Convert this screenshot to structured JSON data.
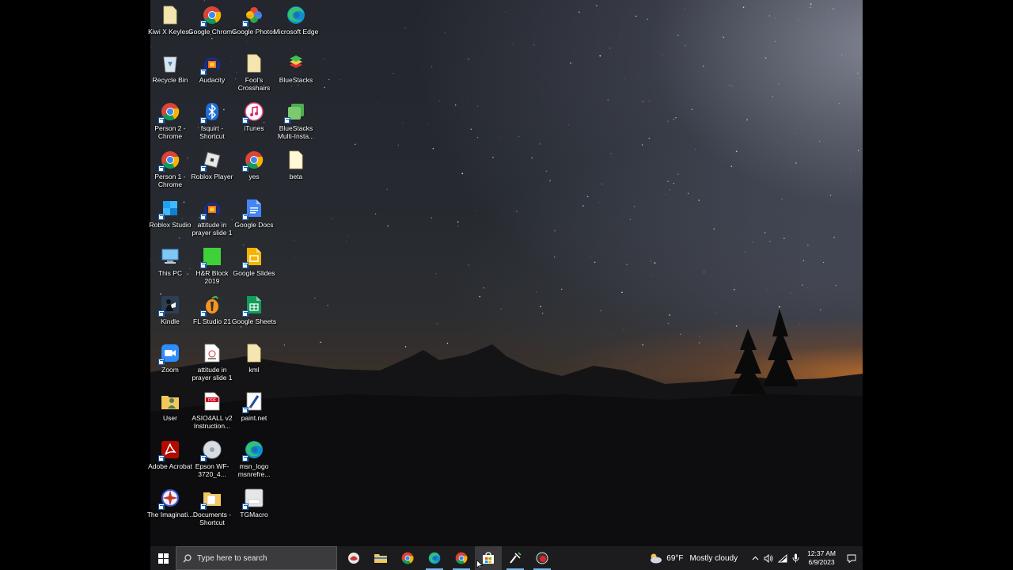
{
  "desktop": {
    "icons": [
      {
        "id": "kiwi",
        "label": "Kiwi X Keyless",
        "icon": "folder-icon"
      },
      {
        "id": "chrome",
        "label": "Google Chrome",
        "icon": "chrome-icon"
      },
      {
        "id": "gphotos",
        "label": "Google Photos",
        "icon": "google-photos-icon"
      },
      {
        "id": "edge",
        "label": "Microsoft Edge",
        "icon": "edge-icon"
      },
      {
        "id": "recycle",
        "label": "Recycle Bin",
        "icon": "recycle-bin-icon"
      },
      {
        "id": "audacity",
        "label": "Audacity",
        "icon": "audacity-icon"
      },
      {
        "id": "fools",
        "label": "Fool's Crosshairs",
        "icon": "folder-icon"
      },
      {
        "id": "bluestacks",
        "label": "BlueStacks",
        "icon": "bluestacks-icon"
      },
      {
        "id": "person2",
        "label": "Person 2 - Chrome",
        "icon": "chrome-icon"
      },
      {
        "id": "fsquirt",
        "label": "fsquirt - Shortcut",
        "icon": "bluetooth-icon"
      },
      {
        "id": "itunes",
        "label": "iTunes",
        "icon": "itunes-icon"
      },
      {
        "id": "bsmulti",
        "label": "BlueStacks Multi-Insta...",
        "icon": "bluestacks-multi-icon"
      },
      {
        "id": "person1",
        "label": "Person 1 - Chrome",
        "icon": "chrome-icon"
      },
      {
        "id": "robloxplayer",
        "label": "Roblox Player",
        "icon": "roblox-icon"
      },
      {
        "id": "yes",
        "label": "yes",
        "icon": "chrome-icon"
      },
      {
        "id": "beta",
        "label": "beta",
        "icon": "file-icon"
      },
      {
        "id": "robloxstudio",
        "label": "Roblox Studio",
        "icon": "roblox-studio-icon"
      },
      {
        "id": "attitude1",
        "label": "attitude in prayer slide 1",
        "icon": "audacity-icon"
      },
      {
        "id": "gdocs",
        "label": "Google Docs",
        "icon": "google-docs-icon"
      },
      {
        "id": "thispc",
        "label": "This PC",
        "icon": "computer-icon"
      },
      {
        "id": "hrblock",
        "label": "H&R Block 2019",
        "icon": "hrblock-icon"
      },
      {
        "id": "gslides",
        "label": "Google Slides",
        "icon": "google-slides-icon"
      },
      {
        "id": "kindle",
        "label": "Kindle",
        "icon": "kindle-icon"
      },
      {
        "id": "flstudio",
        "label": "FL Studio 21",
        "icon": "fl-studio-icon"
      },
      {
        "id": "gsheets",
        "label": "Google Sheets",
        "icon": "google-sheets-icon"
      },
      {
        "id": "zoom",
        "label": "Zoom",
        "icon": "zoom-icon"
      },
      {
        "id": "attitude2",
        "label": "attitude in prayer slide 1",
        "icon": "mp3-file-icon"
      },
      {
        "id": "kml",
        "label": "kml",
        "icon": "folder-icon"
      },
      {
        "id": "user",
        "label": "User",
        "icon": "user-folder-icon"
      },
      {
        "id": "asio",
        "label": "ASIO4ALL v2 Instruction...",
        "icon": "pdf-icon"
      },
      {
        "id": "paintnet",
        "label": "paint.net",
        "icon": "paintnet-icon"
      },
      {
        "id": "acrobat",
        "label": "Adobe Acrobat",
        "icon": "acrobat-icon"
      },
      {
        "id": "epson",
        "label": "Epson WF-3720_4...",
        "icon": "printer-disc-icon"
      },
      {
        "id": "msnlogo",
        "label": "msn_logo msnrefre...",
        "icon": "edge-icon"
      },
      {
        "id": "imaginati",
        "label": "The Imaginati...",
        "icon": "imaginati-icon"
      },
      {
        "id": "documents",
        "label": "Documents - Shortcut",
        "icon": "documents-folder-icon"
      },
      {
        "id": "tgmacro",
        "label": "TGMacro",
        "icon": "tgmacro-icon"
      }
    ]
  },
  "taskbar": {
    "search_placeholder": "Type here to search",
    "apps": [
      {
        "name": "taskbar-app-avatar",
        "icon": "avatar-icon",
        "active": false
      },
      {
        "name": "taskbar-app-file-explorer",
        "icon": "file-explorer-icon",
        "active": false
      },
      {
        "name": "taskbar-app-chrome",
        "icon": "chrome-icon",
        "active": false
      },
      {
        "name": "taskbar-app-edge",
        "icon": "edge-icon",
        "active": true
      },
      {
        "name": "taskbar-app-chrome-profile",
        "icon": "chrome-icon",
        "active": true
      },
      {
        "name": "taskbar-app-store",
        "icon": "store-icon",
        "active": false
      },
      {
        "name": "taskbar-app-tool",
        "icon": "tool-icon",
        "active": true
      },
      {
        "name": "taskbar-app-recorder",
        "icon": "recorder-icon",
        "active": true
      }
    ],
    "weather": {
      "temp": "69°F",
      "condition": "Mostly cloudy"
    },
    "clock": {
      "time": "12:37 AM",
      "date": "6/9/2023"
    }
  },
  "colors": {
    "taskbar_bg": "#1c1c1e",
    "search_bg": "#3b3b3d",
    "accent": "#76b9ed"
  }
}
